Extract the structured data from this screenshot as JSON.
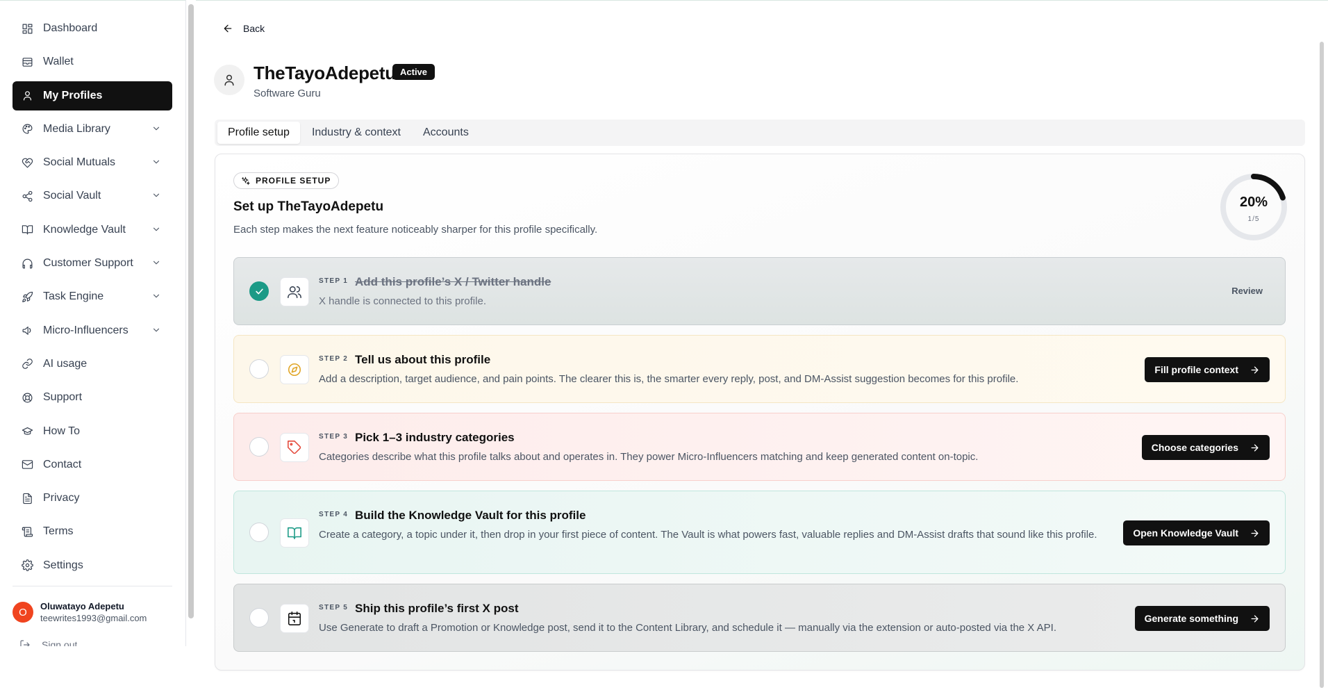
{
  "sidebar": {
    "items": [
      {
        "label": "Dashboard",
        "icon": "dashboard-icon",
        "active": false,
        "expandable": false
      },
      {
        "label": "Wallet",
        "icon": "wallet-icon",
        "active": false,
        "expandable": false
      },
      {
        "label": "My Profiles",
        "icon": "user-icon",
        "active": true,
        "expandable": false
      },
      {
        "label": "Media Library",
        "icon": "palette-icon",
        "active": false,
        "expandable": true
      },
      {
        "label": "Social Mutuals",
        "icon": "heart-handshake-icon",
        "active": false,
        "expandable": true
      },
      {
        "label": "Social Vault",
        "icon": "share-icon",
        "active": false,
        "expandable": true
      },
      {
        "label": "Knowledge Vault",
        "icon": "book-icon",
        "active": false,
        "expandable": true
      },
      {
        "label": "Customer Support",
        "icon": "headphones-icon",
        "active": false,
        "expandable": true
      },
      {
        "label": "Task Engine",
        "icon": "rocket-icon",
        "active": false,
        "expandable": true
      },
      {
        "label": "Micro-Influencers",
        "icon": "megaphone-icon",
        "active": false,
        "expandable": true
      },
      {
        "label": "AI usage",
        "icon": "link-icon",
        "active": false,
        "expandable": false
      },
      {
        "label": "Support",
        "icon": "lifebuoy-icon",
        "active": false,
        "expandable": false
      },
      {
        "label": "How To",
        "icon": "graduation-cap-icon",
        "active": false,
        "expandable": false
      },
      {
        "label": "Contact",
        "icon": "mail-icon",
        "active": false,
        "expandable": false
      },
      {
        "label": "Privacy",
        "icon": "file-icon",
        "active": false,
        "expandable": false
      },
      {
        "label": "Terms",
        "icon": "scroll-icon",
        "active": false,
        "expandable": false
      },
      {
        "label": "Settings",
        "icon": "gear-icon",
        "active": false,
        "expandable": false
      }
    ],
    "user": {
      "initial": "O",
      "name": "Oluwatayo Adepetu",
      "email": "teewrites1993@gmail.com"
    },
    "signout_label": "Sign out"
  },
  "header": {
    "back_label": "Back",
    "profile_name": "TheTayoAdepetu",
    "status_badge": "Active",
    "subtitle": "Software Guru"
  },
  "tabs": [
    {
      "label": "Profile setup",
      "active": true
    },
    {
      "label": "Industry & context",
      "active": false
    },
    {
      "label": "Accounts",
      "active": false
    }
  ],
  "setup": {
    "chip_label": "PROFILE SETUP",
    "title": "Set up TheTayoAdepetu",
    "description": "Each step makes the next feature noticeably sharper for this profile specifically.",
    "progress_percent": "20%",
    "progress_count": "1/5",
    "progress_fraction": 0.2,
    "steps": [
      {
        "number": "STEP 1",
        "title": "Add this profile’s X / Twitter handle",
        "description": "X handle is connected to this profile.",
        "done": true,
        "icon": "users-icon",
        "action": "Review"
      },
      {
        "number": "STEP 2",
        "title": "Tell us about this profile",
        "description": "Add a description, target audience, and pain points. The clearer this is, the smarter every reply, post, and DM-Assist suggestion becomes for this profile.",
        "done": false,
        "icon": "compass-icon",
        "action": "Fill profile context"
      },
      {
        "number": "STEP 3",
        "title": "Pick 1–3 industry categories",
        "description": "Categories describe what this profile talks about and operates in. They power Micro-Influencers matching and keep generated content on-topic.",
        "done": false,
        "icon": "tag-icon",
        "action": "Choose categories"
      },
      {
        "number": "STEP 4",
        "title": "Build the Knowledge Vault for this profile",
        "description": "Create a category, a topic under it, then drop in your first piece of content. The Vault is what powers fast, valuable replies and DM-Assist drafts that sound like this profile.",
        "done": false,
        "icon": "book-open-icon",
        "action": "Open Knowledge Vault"
      },
      {
        "number": "STEP 5",
        "title": "Ship this profile’s first X post",
        "description": "Use Generate to draft a Promotion or Knowledge post, send it to the Content Library, and schedule it — manually via the extension or auto-posted via the X API.",
        "done": false,
        "icon": "calendar-icon",
        "action": "Generate something"
      }
    ]
  },
  "colors": {
    "accent": "#111111",
    "done_green": "#1b9a86",
    "avatar_orange": "#f0441f",
    "compass_yellow": "#e0a526",
    "tag_red": "#e4483a",
    "book_teal": "#1b9a86"
  }
}
